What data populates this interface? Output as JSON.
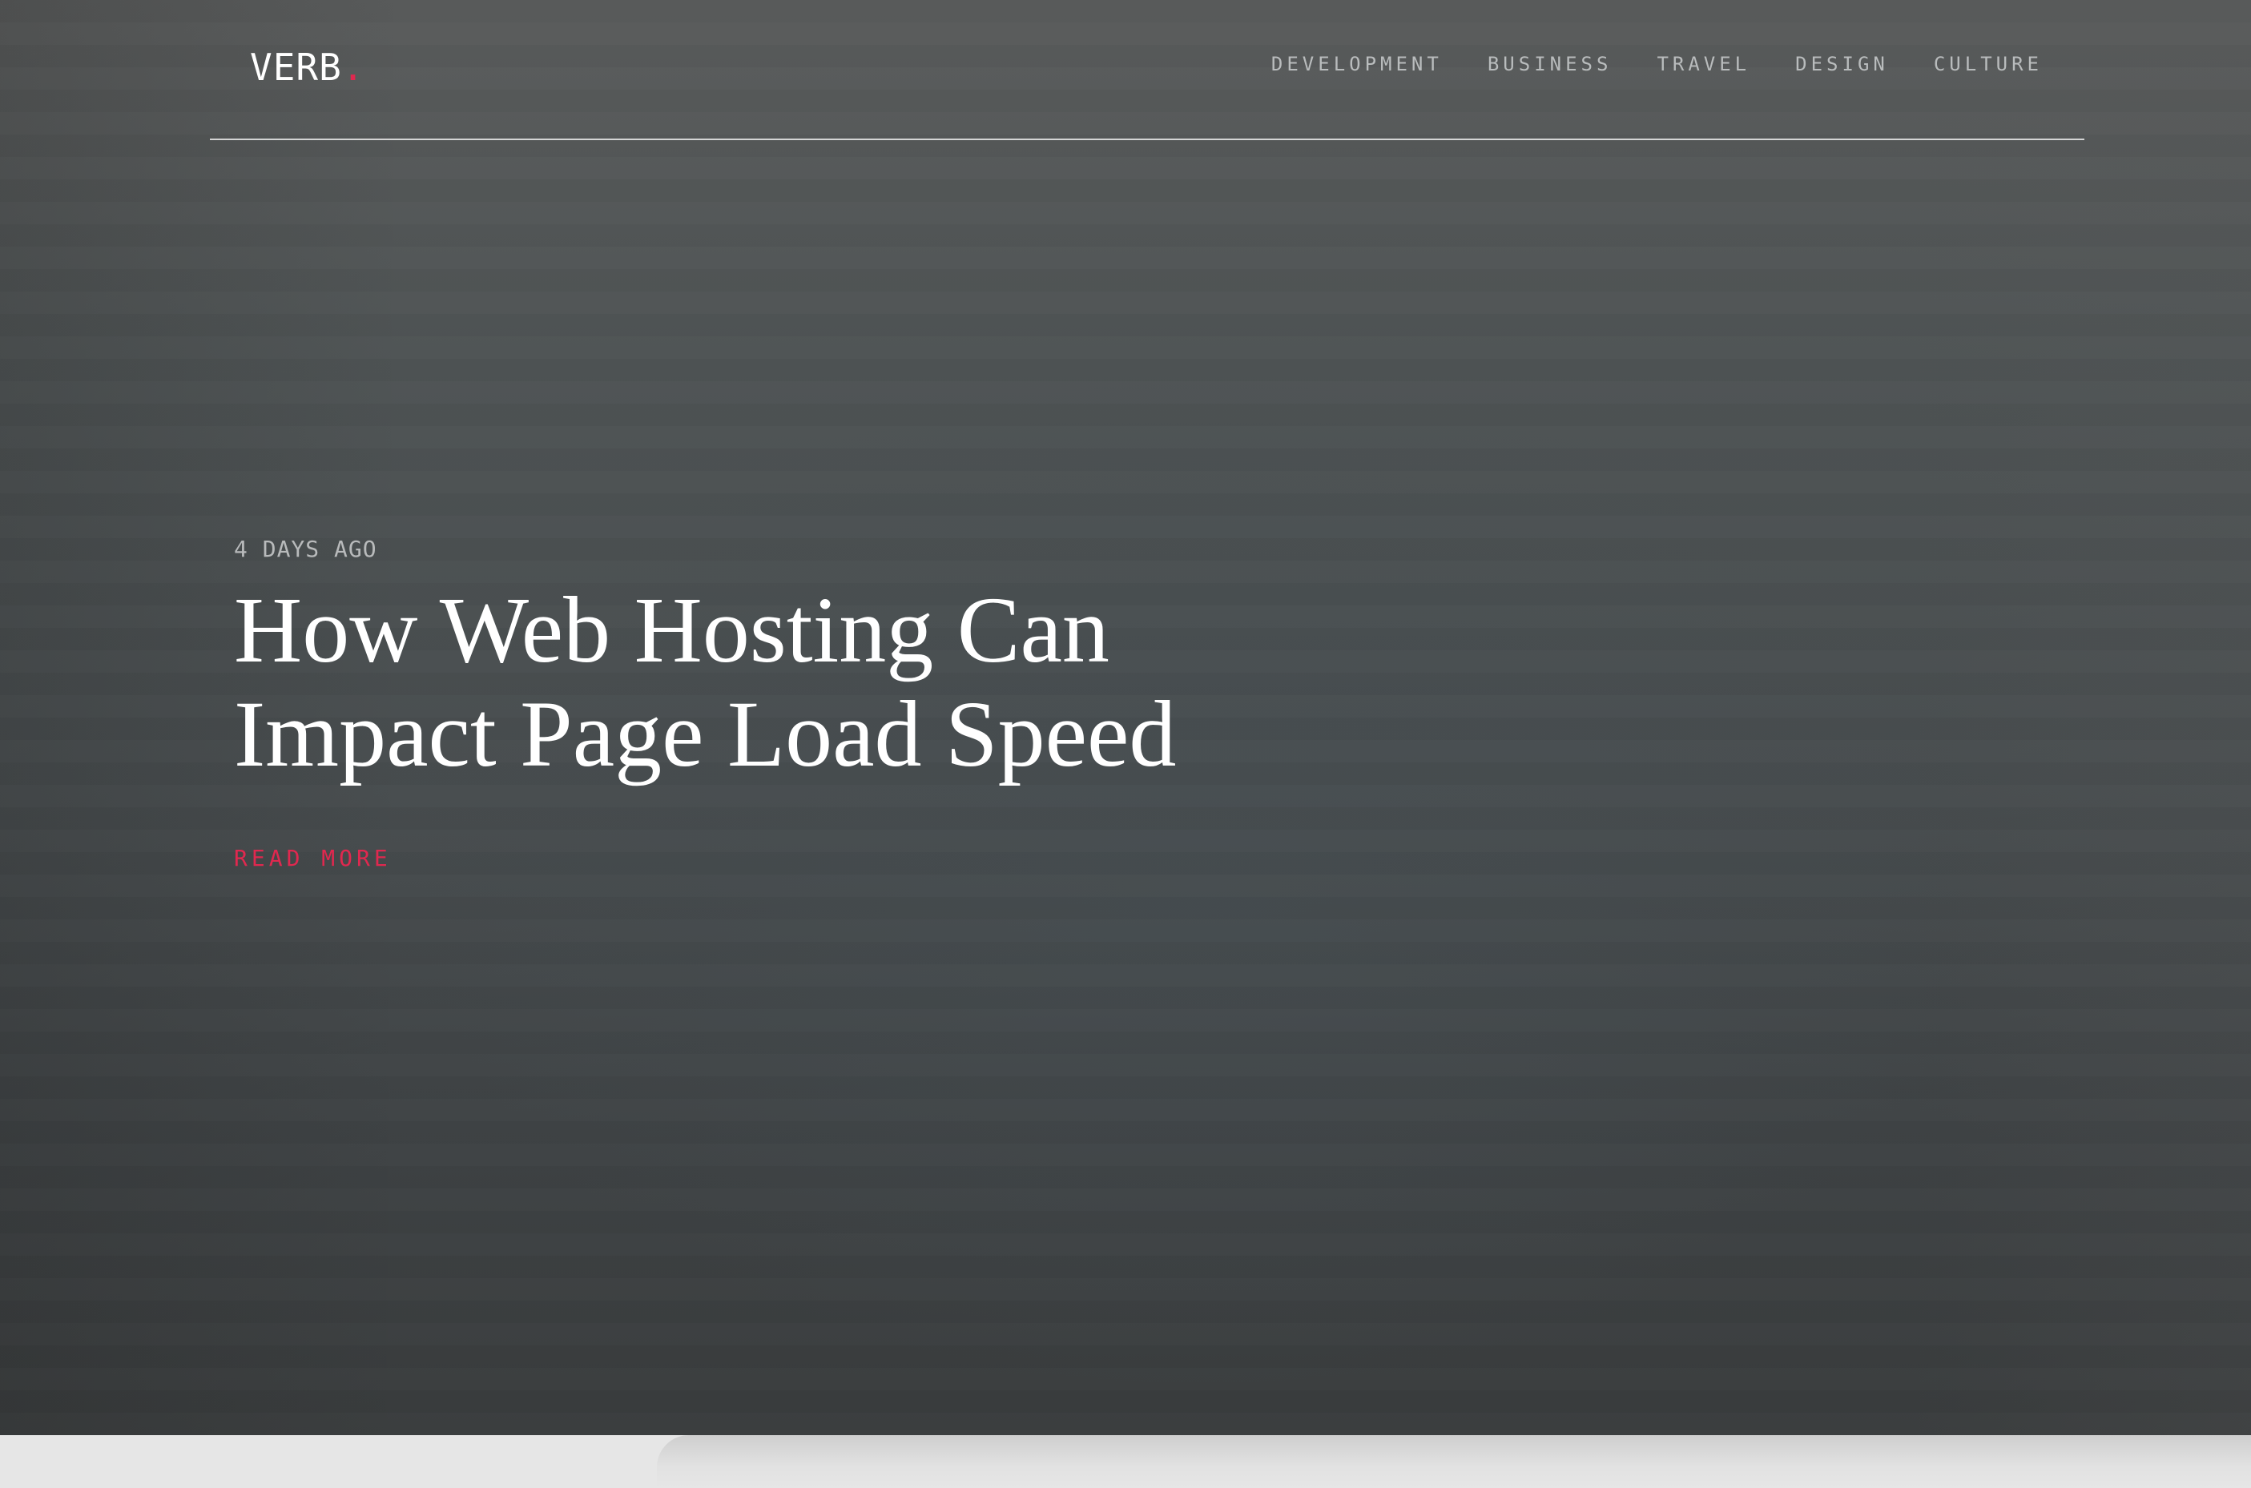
{
  "header": {
    "logo_text": "VERB",
    "logo_dot": ".",
    "nav": [
      {
        "label": "DEVELOPMENT"
      },
      {
        "label": "BUSINESS"
      },
      {
        "label": "TRAVEL"
      },
      {
        "label": "DESIGN"
      },
      {
        "label": "CULTURE"
      }
    ]
  },
  "hero": {
    "meta": "4 DAYS AGO",
    "title_line1": "How Web Hosting Can",
    "title_line2": "Impact Page Load Speed",
    "read_more": "READ MORE"
  },
  "colors": {
    "accent": "#e0284f",
    "nav_text": "#b9bcbd",
    "title_text": "#ffffff",
    "page_bg": "#e6e6e6"
  }
}
